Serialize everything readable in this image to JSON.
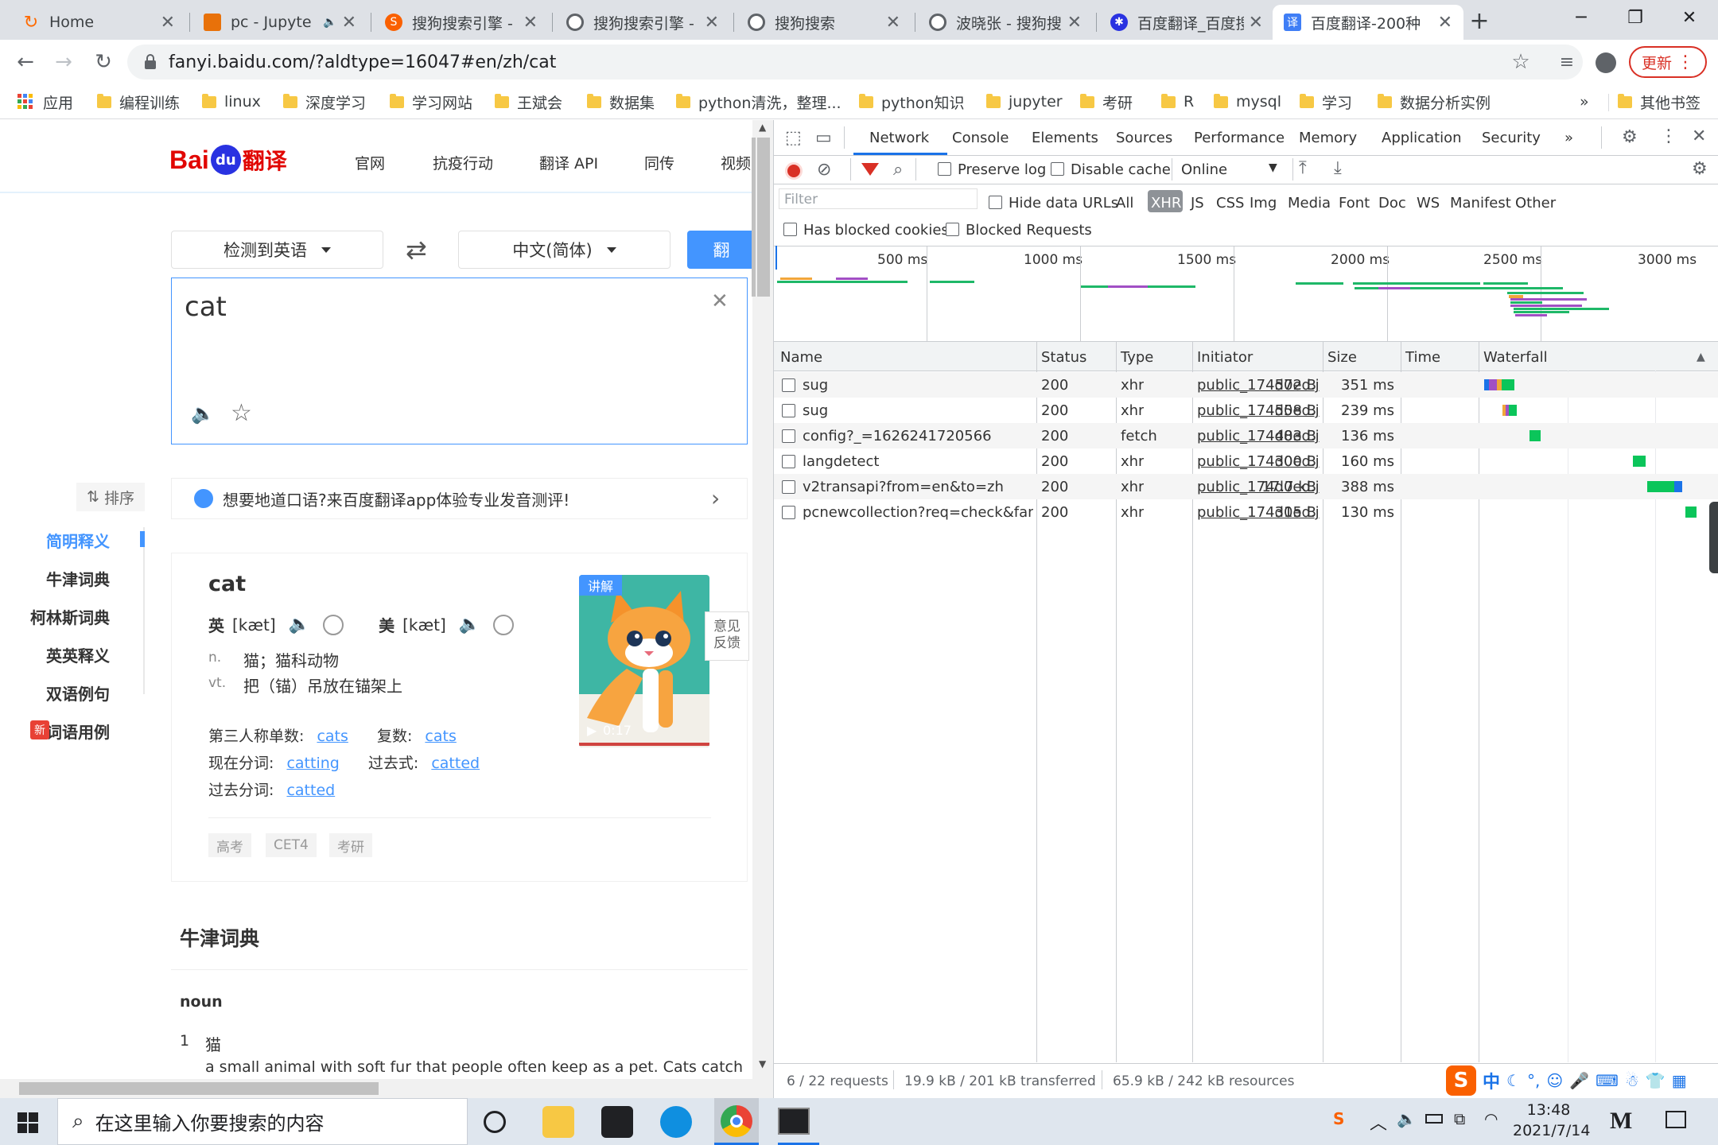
{
  "browser": {
    "tabs": [
      {
        "title": "Home",
        "color": "#ff6a00"
      },
      {
        "title": "pc - Jupyte",
        "color": "#e8710a"
      },
      {
        "title": "搜狗搜索引擎 -",
        "color": "#fa6000"
      },
      {
        "title": "搜狗搜索引擎 -",
        "color": "#5f6368"
      },
      {
        "title": "搜狗搜索",
        "color": "#5f6368"
      },
      {
        "title": "波晓张 - 搜狗搜",
        "color": "#5f6368"
      },
      {
        "title": "百度翻译_百度搜",
        "color": "#2932e1"
      },
      {
        "title": "百度翻译-200种",
        "color": "#3f7ef6"
      }
    ],
    "new_tab": "+",
    "url": "fanyi.baidu.com/?aldtype=16047#en/zh/cat",
    "update_label": "更新",
    "bookmarks": [
      "应用",
      "编程训练",
      "linux",
      "深度学习",
      "学习网站",
      "王斌会",
      "数据集",
      "python清洗，整理...",
      "python知识",
      "jupyter",
      "考研",
      "R",
      "mysql",
      "学习",
      "数据分析实例"
    ],
    "more_bookmarks": "»",
    "other_bookmarks": "其他书签"
  },
  "page": {
    "logo_text": "Bai",
    "logo_du": "du",
    "logo_fanyi": "翻译",
    "nav": [
      "官网",
      "抗疫行动",
      "翻译 API",
      "同传",
      "视频"
    ],
    "source_lang": "检测到英语",
    "target_lang": "中文(简体)",
    "translate_btn": "翻",
    "input_text": "cat",
    "sort_label": "排序",
    "promo_text": "想要地道口语?来百度翻译app体验专业发音测评!",
    "side_nav": [
      "简明释义",
      "牛津词典",
      "柯林斯词典",
      "英英释义",
      "双语例句",
      "词语用例"
    ],
    "new_badge": "新",
    "word": "cat",
    "uk_label": "英",
    "uk_phonetic": "[kæt]",
    "us_label": "美",
    "us_phonetic": "[kæt]",
    "defs": [
      {
        "pos": "n.",
        "text": "猫；猫科动物"
      },
      {
        "pos": "vt.",
        "text": "把（锚）吊放在锚架上"
      }
    ],
    "forms": {
      "third_label": "第三人称单数:",
      "third": "cats",
      "plural_label": "复数:",
      "plural": "cats",
      "present_label": "现在分词:",
      "present": "catting",
      "past_label": "过去式:",
      "past": "catted",
      "pp_label": "过去分词:",
      "pp": "catted"
    },
    "tags": [
      "高考",
      "CET4",
      "考研"
    ],
    "video_badge": "讲解",
    "video_time": "0:17",
    "feedback": "意见反馈",
    "oxford_title": "牛津词典",
    "oxford_pos": "noun",
    "oxford_num": "1",
    "oxford_zh": "猫",
    "oxford_def": "a small animal with soft fur that people often keep as a pet. Cats catch"
  },
  "devtools": {
    "tabs": [
      "Network",
      "Console",
      "Elements",
      "Sources",
      "Performance",
      "Memory",
      "Application",
      "Security"
    ],
    "more": "»",
    "preserve_log": "Preserve log",
    "disable_cache": "Disable cache",
    "throttle": "Online",
    "filter_placeholder": "Filter",
    "hide_data_urls": "Hide data URLs",
    "types": [
      "All",
      "XHR",
      "JS",
      "CSS",
      "Img",
      "Media",
      "Font",
      "Doc",
      "WS",
      "Manifest",
      "Other"
    ],
    "has_blocked": "Has blocked cookies",
    "blocked_requests": "Blocked Requests",
    "ticks": [
      "500 ms",
      "1000 ms",
      "1500 ms",
      "2000 ms",
      "2500 ms",
      "3000 ms"
    ],
    "columns": [
      "Name",
      "Status",
      "Type",
      "Initiator",
      "Size",
      "Time",
      "Waterfall"
    ],
    "rows": [
      {
        "name": "sug",
        "status": "200",
        "type": "xhr",
        "initiator": "public_174d0ed.j...",
        "size": "572 B",
        "time": "351 ms"
      },
      {
        "name": "sug",
        "status": "200",
        "type": "xhr",
        "initiator": "public_174d0ed.j...",
        "size": "558 B",
        "time": "239 ms"
      },
      {
        "name": "config?_=1626241720566",
        "status": "200",
        "type": "fetch",
        "initiator": "public_174d0ed.j...",
        "size": "483 B",
        "time": "136 ms"
      },
      {
        "name": "langdetect",
        "status": "200",
        "type": "xhr",
        "initiator": "public_174d0ed.j...",
        "size": "300 B",
        "time": "160 ms"
      },
      {
        "name": "v2transapi?from=en&to=zh",
        "status": "200",
        "type": "xhr",
        "initiator": "public_174d0ed.j...",
        "size": "17.7 kB",
        "time": "388 ms"
      },
      {
        "name": "pcnewcollection?req=check&fanyi...",
        "status": "200",
        "type": "xhr",
        "initiator": "public_174d0ed.j...",
        "size": "315 B",
        "time": "130 ms"
      }
    ],
    "status_requests": "6 / 22 requests",
    "status_transferred": "19.9 kB / 201 kB transferred",
    "status_resources": "65.9 kB / 242 kB resources"
  },
  "taskbar": {
    "search_placeholder": "在这里输入你要搜索的内容",
    "ime": "中",
    "time": "13:48",
    "date": "2021/7/14"
  }
}
